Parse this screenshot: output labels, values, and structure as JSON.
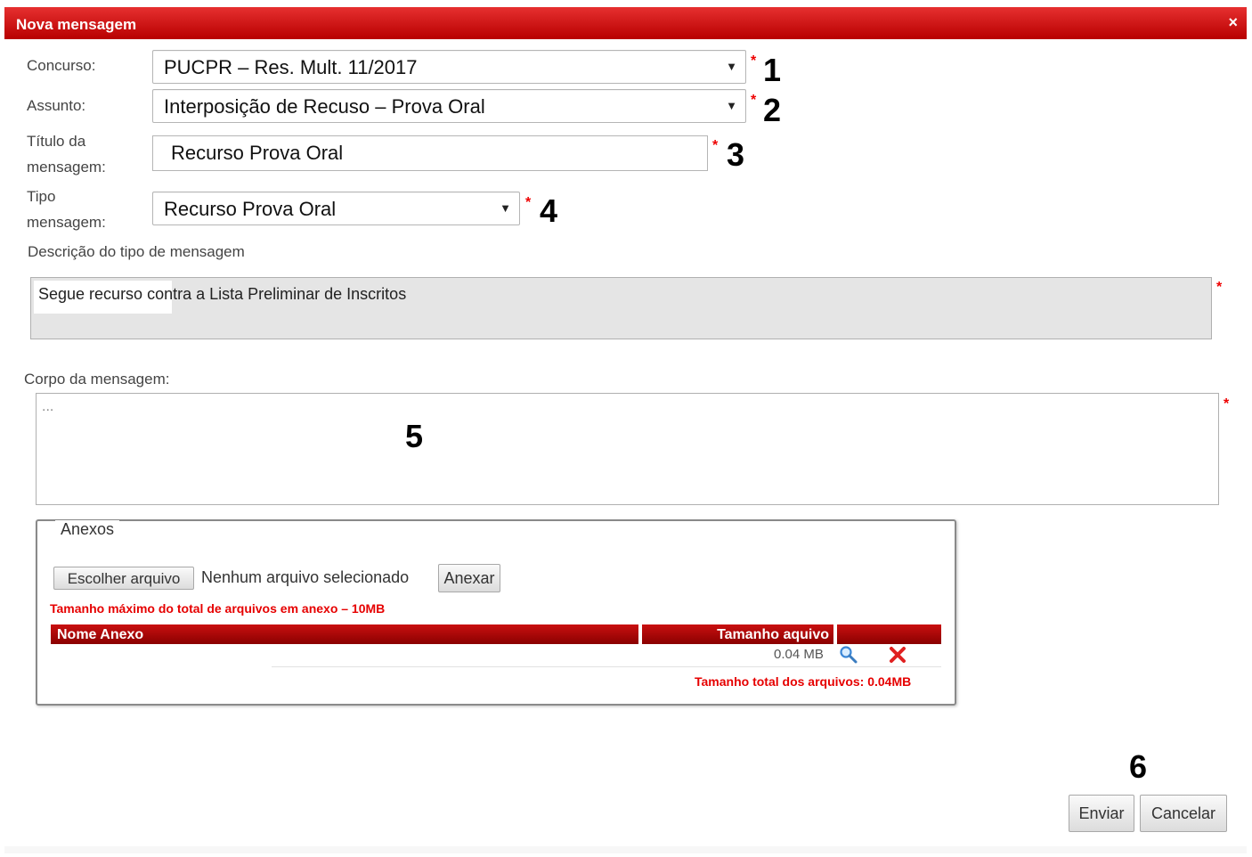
{
  "dialog": {
    "title": "Nova mensagem",
    "close_glyph": "×"
  },
  "form": {
    "concurso": {
      "label": "Concurso:",
      "value": "PUCPR – Res. Mult. 11/2017"
    },
    "assunto": {
      "label": "Assunto:",
      "value": "Interposição de Recuso – Prova Oral"
    },
    "titulo": {
      "label_line1": "Título da",
      "label_line2": "mensagem:",
      "value": "Recurso Prova Oral"
    },
    "tipo": {
      "label_line1": "Tipo",
      "label_line2": "mensagem:",
      "value": "Recurso Prova Oral"
    },
    "descricao": {
      "label": "Descrição do tipo de mensagem",
      "value": "Segue recurso contra a Lista Preliminar de Inscritos"
    },
    "corpo": {
      "label": "Corpo da mensagem:",
      "value": "..."
    },
    "required_marker": "*"
  },
  "annotations": {
    "n1": "1",
    "n2": "2",
    "n3": "3",
    "n4": "4",
    "n5": "5",
    "n6": "6"
  },
  "anexos": {
    "legend": "Anexos",
    "choose_button": "Escolher arquivo",
    "no_file_text": "Nenhum arquivo selecionado",
    "attach_button": "Anexar",
    "max_size_note": "Tamanho máximo do total de arquivos em anexo – 10MB",
    "columns": [
      "Nome Anexo",
      "Tamanho aquivo"
    ],
    "rows": [
      {
        "name": "",
        "size": "0.04 MB"
      }
    ],
    "total_note": "Tamanho total dos arquivos: 0.04MB"
  },
  "footer": {
    "send_button": "Enviar",
    "cancel_button": "Cancelar"
  },
  "icons": {
    "close": "close-icon",
    "dropdown": "chevron-down-icon",
    "view": "magnifier-icon",
    "delete": "delete-x-icon"
  },
  "colors": {
    "title_bar": "#d40000",
    "required": "#e00000",
    "table_header": "#a80000",
    "note": "#e60000"
  }
}
